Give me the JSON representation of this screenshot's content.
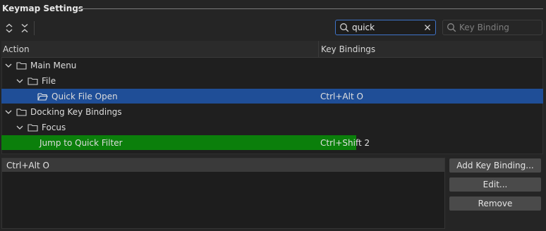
{
  "header": {
    "title": "Keymap Settings"
  },
  "toolbar": {
    "expand_all_icon": "expand-all-icon",
    "collapse_all_icon": "collapse-all-icon"
  },
  "search": {
    "action_value": "quick",
    "action_icon": "search-icon",
    "clear_icon": "close-icon",
    "keybinding_placeholder": "Key Binding",
    "keybinding_value": ""
  },
  "table": {
    "columns": [
      "Action",
      "Key Bindings"
    ],
    "rows": [
      {
        "label": "Main Menu",
        "keybinding": "",
        "level": 0,
        "type": "folder",
        "expanded": true
      },
      {
        "label": "File",
        "keybinding": "",
        "level": 1,
        "type": "folder",
        "expanded": true
      },
      {
        "label": "Quick File Open",
        "keybinding": "Ctrl+Alt O",
        "level": 2,
        "type": "action-folder-open",
        "selected": true
      },
      {
        "label": "Docking Key Bindings",
        "keybinding": "",
        "level": 0,
        "type": "folder",
        "expanded": true
      },
      {
        "label": "Focus",
        "keybinding": "",
        "level": 1,
        "type": "folder",
        "expanded": true
      },
      {
        "label": "Jump to Quick Filter",
        "keybinding": "Ctrl+Shift 2",
        "level": 2,
        "type": "action",
        "highlight": "green"
      }
    ]
  },
  "bindings_list": {
    "items": [
      "Ctrl+Alt O"
    ]
  },
  "buttons": {
    "add": "Add Key Binding...",
    "edit": "Edit...",
    "remove": "Remove"
  },
  "colors": {
    "selection": "#1f4e97",
    "highlight_green": "#0b7f0b",
    "search_focus": "#3f74c8"
  }
}
